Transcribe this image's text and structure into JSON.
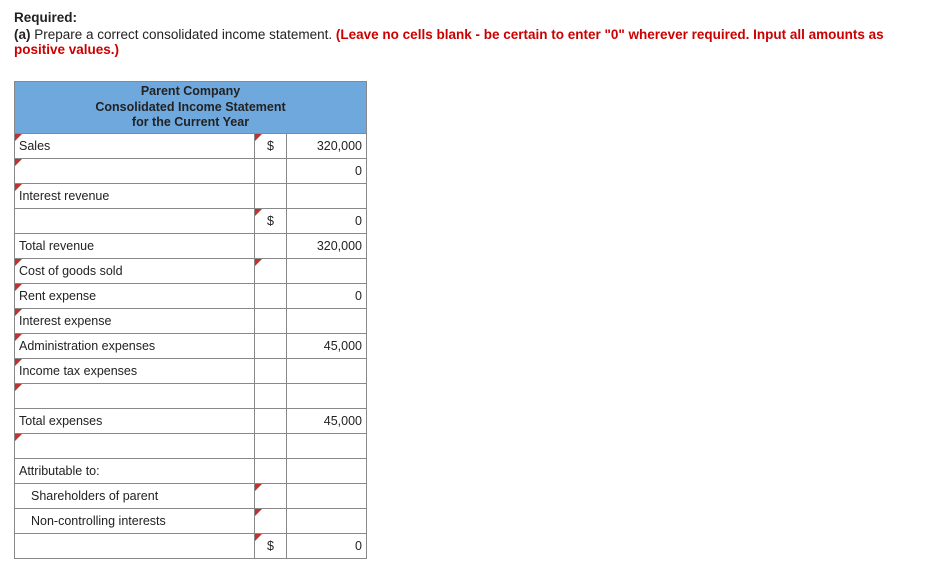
{
  "instructions": {
    "required": "Required:",
    "part_label": "(a)",
    "part_text": " Prepare a correct consolidated income statement. ",
    "note": "(Leave no cells blank - be certain to enter \"0\" wherever required. Input all amounts as positive values.)"
  },
  "table": {
    "header_line1": "Parent Company",
    "header_line2": "Consolidated Income Statement",
    "header_line3": "for the Current Year",
    "rows": {
      "sales": {
        "label": "Sales",
        "cur": "$",
        "val": "320,000"
      },
      "blank1": {
        "label": "",
        "cur": "",
        "val": "0"
      },
      "interest_revenue": {
        "label": "Interest revenue",
        "cur": "",
        "val": ""
      },
      "blank2": {
        "label": "",
        "cur": "$",
        "val": "0"
      },
      "total_revenue": {
        "label": "Total revenue",
        "cur": "",
        "val": "320,000"
      },
      "cogs": {
        "label": "Cost of goods sold",
        "cur": "",
        "val": ""
      },
      "rent_expense": {
        "label": "Rent expense",
        "cur": "",
        "val": "0"
      },
      "interest_expense": {
        "label": "Interest expense",
        "cur": "",
        "val": ""
      },
      "admin_expenses": {
        "label": "Administration expenses",
        "cur": "",
        "val": "45,000"
      },
      "income_tax": {
        "label": "Income tax expenses",
        "cur": "",
        "val": ""
      },
      "blank3": {
        "label": "",
        "cur": "",
        "val": ""
      },
      "total_expenses": {
        "label": "Total expenses",
        "cur": "",
        "val": "45,000"
      },
      "blank4": {
        "label": "",
        "cur": "",
        "val": ""
      },
      "attributable": {
        "label": "Attributable to:",
        "cur": "",
        "val": ""
      },
      "shareholders": {
        "label": "Shareholders of parent",
        "cur": "",
        "val": ""
      },
      "nci": {
        "label": "Non-controlling interests",
        "cur": "",
        "val": ""
      },
      "final": {
        "label": "",
        "cur": "$",
        "val": "0"
      }
    }
  }
}
